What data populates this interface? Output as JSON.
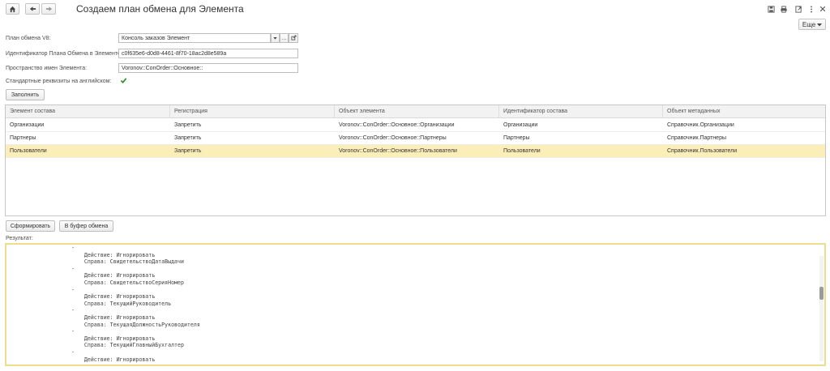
{
  "window": {
    "title": "Создаем план обмена для Элемента",
    "more_label": "Еще"
  },
  "form": {
    "plan_label": "План обмена V8:",
    "plan_value": "Консоль заказов Элемент",
    "id_label": "Идентификатор Плана Обмена в Элементе:",
    "id_value": "c0f635e6-d0d8-4461-8f70-18ac2d8e589a",
    "namespace_label": "Пространство имен Элемента:",
    "namespace_value": "Voronov::ConOrder::Основное::",
    "english_label": "Стандартные реквизиты на английском:",
    "english_checked": true,
    "fill_button": "Заполнить"
  },
  "table": {
    "columns": [
      "Элемент состава",
      "Регистрация",
      "Объект элемента",
      "Идентификатор состава",
      "Объект метаданных"
    ],
    "rows": [
      [
        "Организации",
        "Запретить",
        "Voronov::ConOrder::Основное::Организации",
        "Организации",
        "Справочник.Организации"
      ],
      [
        "Партнеры",
        "Запретить",
        "Voronov::ConOrder::Основное::Партнеры",
        "Партнеры",
        "Справочник.Партнеры"
      ],
      [
        "Пользователи",
        "Запретить",
        "Voronov::ConOrder::Основное::Пользователи",
        "Пользователи",
        "Справочник.Пользователи"
      ]
    ],
    "selected_row": 2
  },
  "actions": {
    "generate_button": "Сформировать",
    "clipboard_button": "В буфер обмена"
  },
  "result": {
    "label": "Результат:",
    "text": "-\n    Действие: Игнорировать\n    Справа: СвидетельствоДатаВыдачи\n-\n    Действие: Игнорировать\n    Справа: СвидетельствоСерияНомер\n-\n    Действие: Игнорировать\n    Справа: ТекущийРуководитель\n-\n    Действие: Игнорировать\n    Справа: ТекущаяДолжностьРуководителя\n-\n    Действие: Игнорировать\n    Справа: ТекущийГлавныйБухгалтер\n-\n    Действие: Игнорировать"
  },
  "icons": {
    "home": "home-icon",
    "back": "arrow-left-icon",
    "forward": "arrow-right-icon",
    "save": "save-icon",
    "print": "print-icon",
    "restore": "restore-window-icon",
    "menu": "more-vertical-icon",
    "close": "close-icon"
  },
  "colors": {
    "selected_row": "#fbeeb8",
    "result_border": "#f0dc8e",
    "checkmark": "#2e8b2e"
  }
}
